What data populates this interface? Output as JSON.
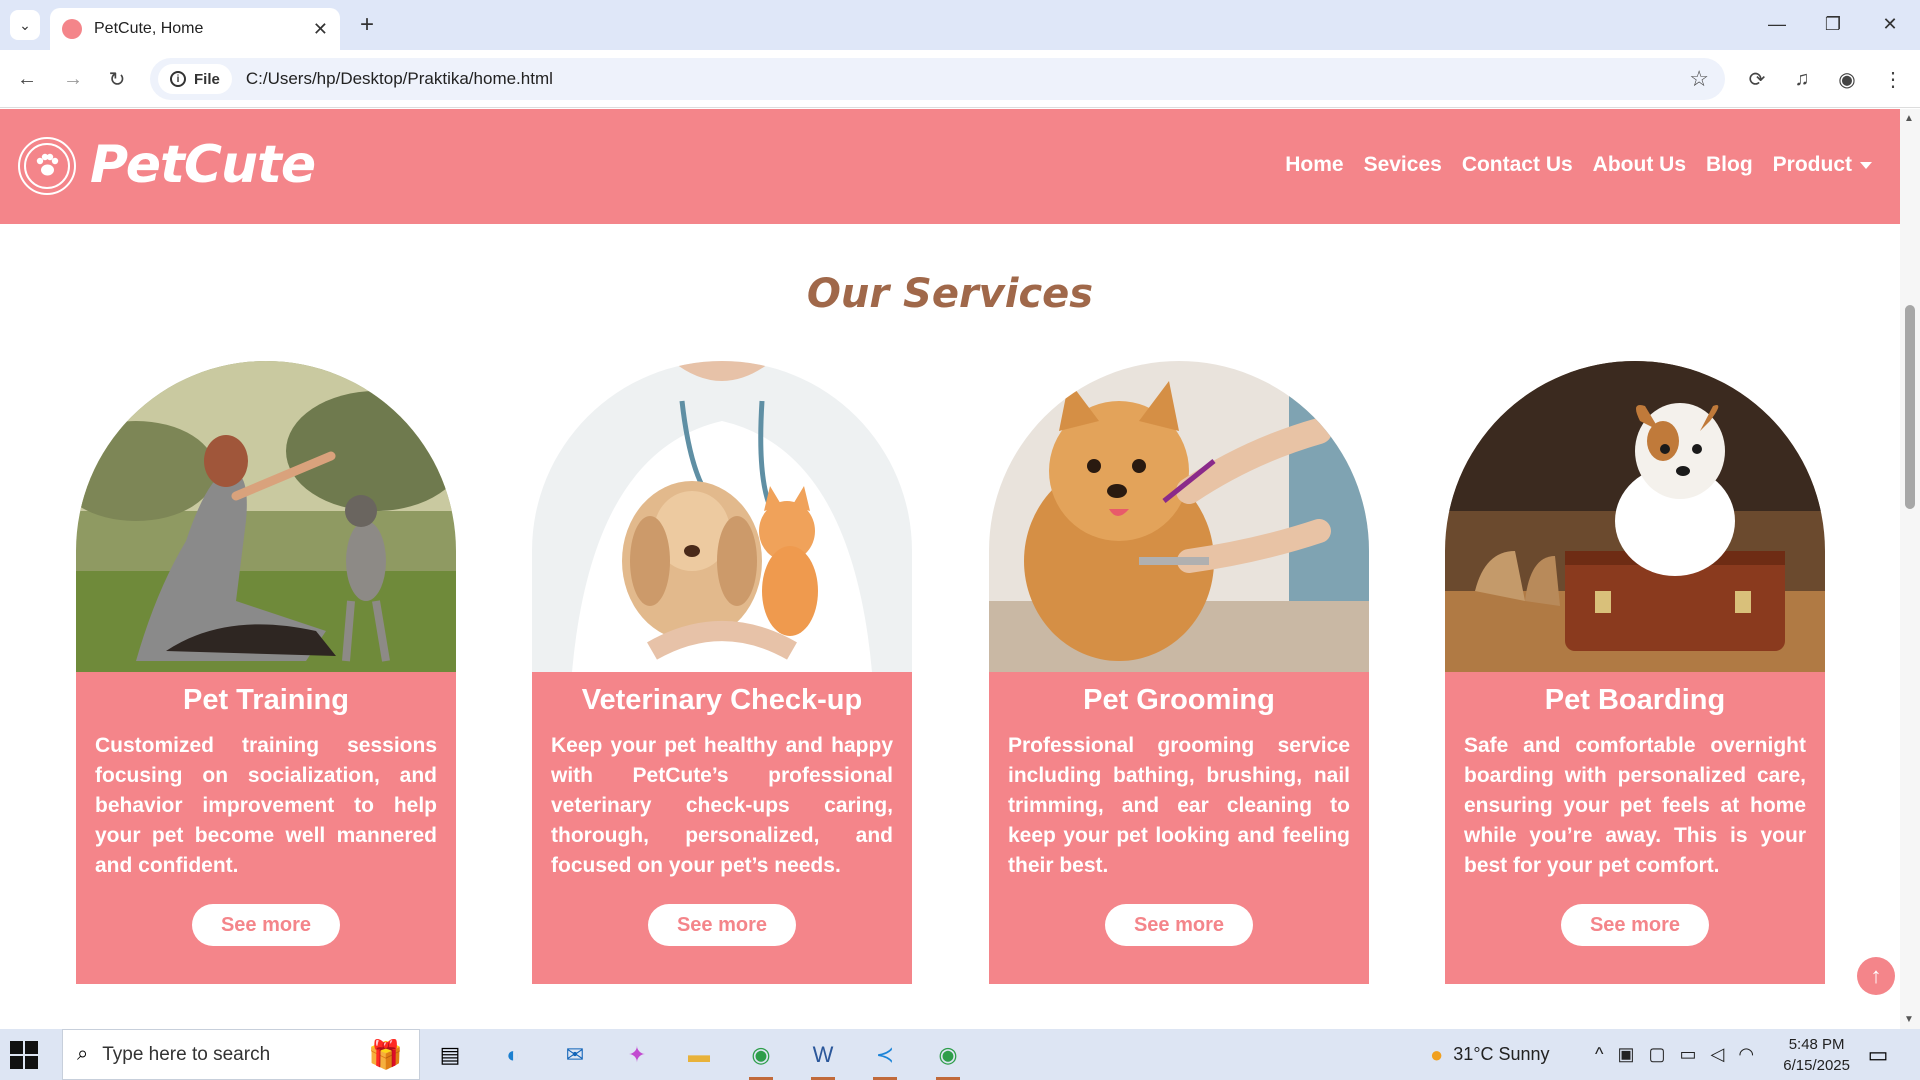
{
  "browser": {
    "tab_title": "PetCute, Home",
    "file_chip": "File",
    "url": "C:/Users/hp/Desktop/Praktika/home.html"
  },
  "site": {
    "logo_text": "PetCute",
    "nav": [
      "Home",
      "Sevices",
      "Contact Us",
      "About Us",
      "Blog",
      "Product"
    ],
    "section_title": "Our Services",
    "cards": [
      {
        "title": "Pet Training",
        "description": "Customized training sessions focusing on socialization, and behavior improvement to help your pet become well mannered and confident.",
        "button": "See more"
      },
      {
        "title": "Veterinary Check-up",
        "description": "Keep your pet healthy and happy with PetCute’s professional veterinary check-ups caring, thorough, personalized, and focused on your pet’s needs.",
        "button": "See more"
      },
      {
        "title": "Pet Grooming",
        "description": "Professional grooming service including bathing, brushing, nail trimming, and ear cleaning to keep your pet looking and feeling their best.",
        "button": "See more"
      },
      {
        "title": "Pet Boarding",
        "description": "Safe and comfortable overnight boarding with personalized care, ensuring your pet feels at home while you’re away. This is your best for your pet comfort.",
        "button": "See more"
      }
    ]
  },
  "taskbar": {
    "search_placeholder": "Type here to search",
    "weather": "31°C  Sunny",
    "time": "5:48 PM",
    "date": "6/15/2025"
  },
  "colors": {
    "brand_pink": "#f4858a",
    "title_brown": "#a0684a"
  }
}
